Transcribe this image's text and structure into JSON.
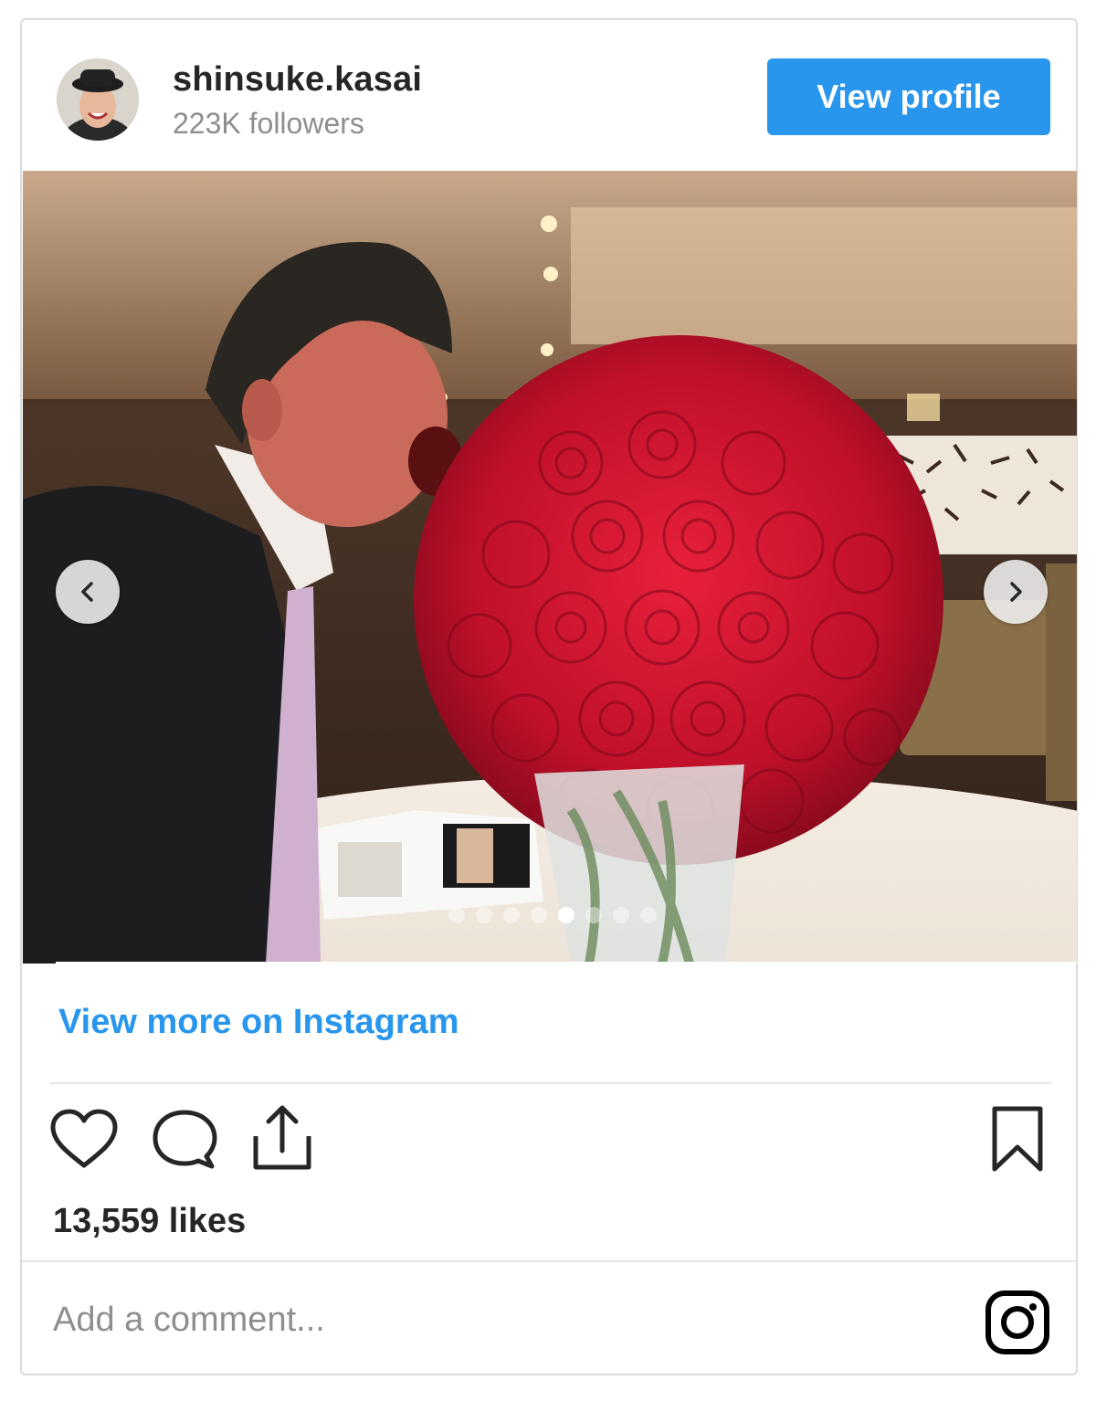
{
  "header": {
    "username": "shinsuke.kasai",
    "followers": "223K followers",
    "view_profile_label": "View profile"
  },
  "media": {
    "carousel_dot_count": 8,
    "active_dot_index": 4
  },
  "links": {
    "view_more_label": "View more on Instagram"
  },
  "actions": {
    "likes_text": "13,559 likes"
  },
  "comment": {
    "placeholder": "Add a comment..."
  },
  "colors": {
    "accent": "#2996ed",
    "text": "#262626",
    "muted": "#8e8e8e",
    "border": "#dbdbdb"
  },
  "icons": [
    "heart-icon",
    "comment-icon",
    "share-icon",
    "bookmark-icon",
    "instagram-logo-icon",
    "chevron-left-icon",
    "chevron-right-icon"
  ]
}
